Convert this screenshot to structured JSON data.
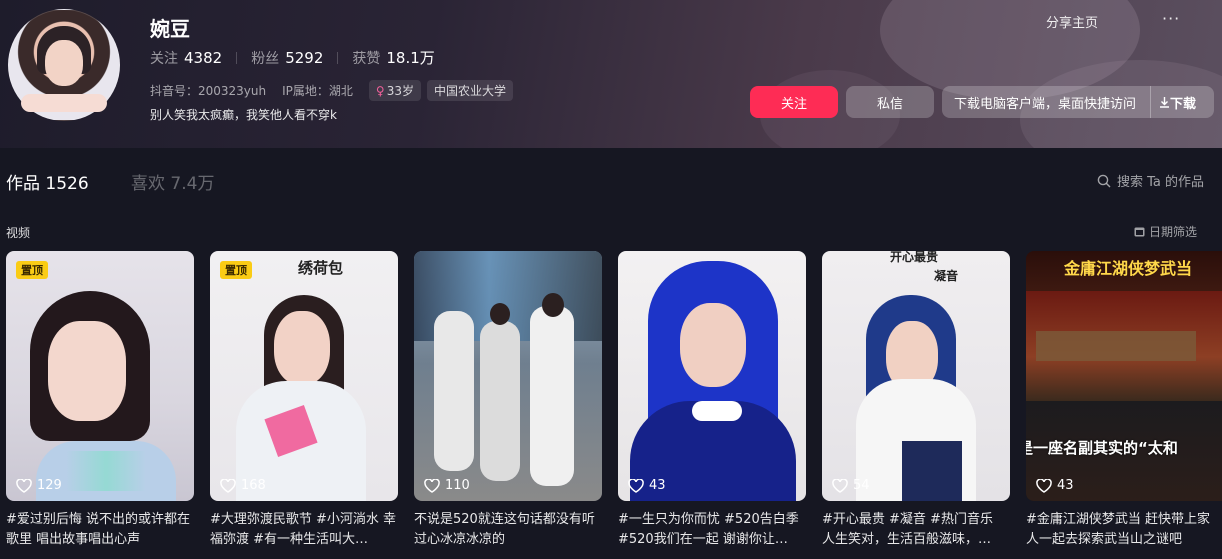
{
  "profile": {
    "name": "婉豆",
    "stats": [
      {
        "label": "关注",
        "value": "4382"
      },
      {
        "label": "粉丝",
        "value": "5292"
      },
      {
        "label": "获赞",
        "value": "18.1万"
      }
    ],
    "douyin_id": "抖音号：200323yuh",
    "ip": "IP属地：湖北",
    "tags": [
      "33岁",
      "中国农业大学"
    ],
    "bio": "别人笑我太疯癫，我笑他人看不穿k"
  },
  "header_actions": {
    "share": "分享主页",
    "more": "···",
    "follow": "关注",
    "message": "私信",
    "download_desktop": "下载电脑客户端，桌面快捷访问",
    "download": "下载"
  },
  "tabs": {
    "works": "作品 1526",
    "likes": "喜欢 7.4万",
    "search": "搜索 Ta 的作品"
  },
  "section": {
    "title": "视频",
    "date_filter": "日期筛选"
  },
  "videos": [
    {
      "pinned": "置顶",
      "likes": "129",
      "caption": "#爱过别后悔 说不出的或许都在歌里 唱出故事唱出心声"
    },
    {
      "pinned": "置顶",
      "likes": "168",
      "caption": "#大理弥渡民歌节 #小河淌水 幸福弥渡 #有一种生活叫大…",
      "overlay": "绣荷包"
    },
    {
      "likes": "110",
      "caption": "不说是520就连这句话都没有听过心冰凉冰凉的"
    },
    {
      "likes": "43",
      "caption": "#一生只为你而忧 #520告白季 #520我们在一起 谢谢你让…"
    },
    {
      "likes": "54",
      "caption": "#开心最贵 #凝音 #热门音乐 人生笑对，生活百般滋味，…",
      "overlay_top": "开心最贵",
      "overlay": "凝音"
    },
    {
      "likes": "43",
      "caption": "#金庸江湖侠梦武当 赶快带上家人一起去探索武当山之谜吧",
      "overlay_top": "金庸江湖侠梦武当",
      "overlay": "是一座名副其实的“太和"
    }
  ],
  "colors": {
    "accent": "#fe2c55",
    "background": "#161722",
    "pinned_badge": "#facc15"
  }
}
